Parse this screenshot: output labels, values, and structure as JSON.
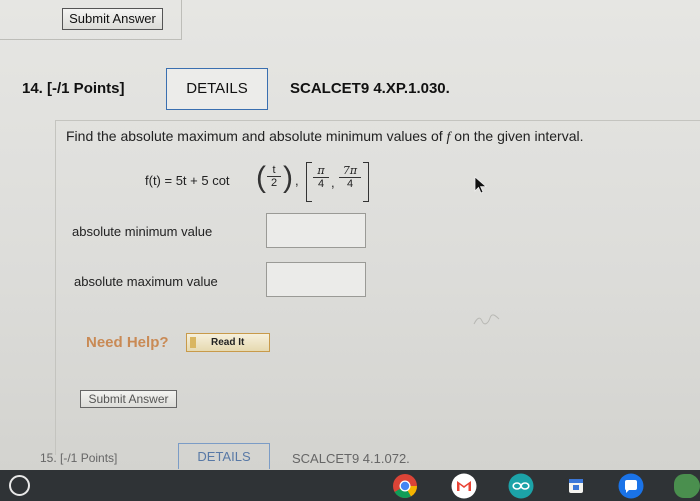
{
  "previous": {
    "submit_label": "Submit Answer"
  },
  "question": {
    "number": "14. [-/1 Points]",
    "details_label": "DETAILS",
    "code": "SCALCET9 4.XP.1.030.",
    "prompt_before": "Find the absolute maximum and absolute minimum values of ",
    "prompt_var": "f",
    "prompt_after": " on the given interval.",
    "formula": {
      "lhs": "f(t) = 5t + 5 cot",
      "frac_num": "t",
      "frac_den": "2",
      "comma": ",",
      "int_a_num": "π",
      "int_a_den": "4",
      "int_b_num": "7π",
      "int_b_den": "4"
    },
    "min_label": "absolute minimum value",
    "min_value": "",
    "max_label": "absolute maximum value",
    "max_value": "",
    "need_help": "Need Help?",
    "read_it": "Read It",
    "submit_label": "Submit Answer"
  },
  "next_question": {
    "number": "15. [-/1 Points]",
    "details_label": "DETAILS",
    "code": "SCALCET9 4.1.072."
  },
  "taskbar": {
    "icons": [
      "launcher-icon",
      "chrome-icon",
      "gmail-icon",
      "arduino-icon",
      "calendar-icon",
      "messages-icon"
    ]
  },
  "colors": {
    "details_border": "#3a6fb0",
    "need_help": "#c98a55",
    "taskbar": "#2f3336"
  }
}
